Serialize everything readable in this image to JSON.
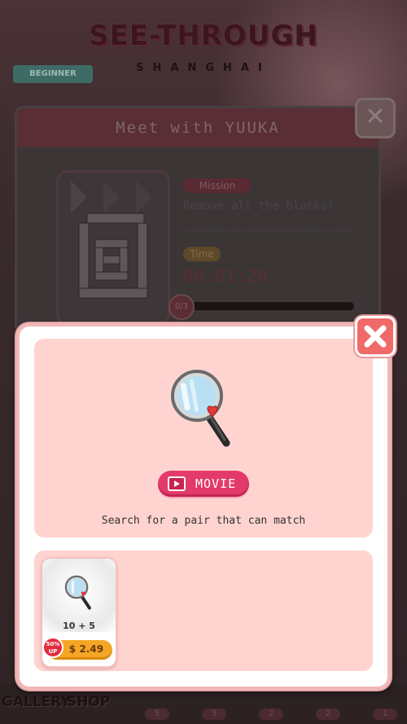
{
  "background": {
    "logo_title": "SEE-THROUGH",
    "logo_subtitle": "SHANGHAI",
    "speech_tag": "BEGINNER",
    "stage_dialog": {
      "title": "Meet with YUUKA",
      "mission_label": "Mission",
      "mission_text": "Remove all the blocks!",
      "time_label": "Time",
      "time_value": "00:01:20",
      "progress": "0/3"
    },
    "bottom_nav": {
      "gallery_label": "GALLERY",
      "shop_label": "SHOP",
      "item_counts": [
        "5",
        "3",
        "2",
        "2",
        "1"
      ]
    }
  },
  "popup": {
    "close_icon": "close-x-icon",
    "item_icon": "magnifier-mirror-icon",
    "movie_button_label": "MOVIE",
    "movie_icon": "film-icon",
    "description": "Search for a pair that can match",
    "products": [
      {
        "quantity": "10 + 5",
        "badge": "50% UP",
        "price": "$ 2.49"
      }
    ]
  },
  "colors": {
    "accent_pink": "#e33a6a",
    "panel_pink": "#ffd4d0",
    "price_orange": "#f5a624",
    "close_red": "#f06a6a"
  }
}
